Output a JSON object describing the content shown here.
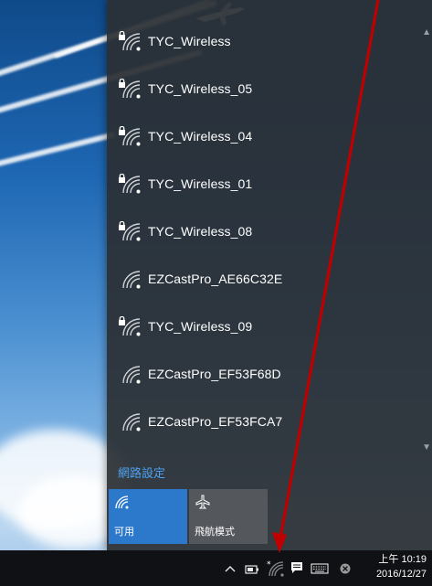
{
  "networks": [
    {
      "name": "TYC_Wireless",
      "secured": true
    },
    {
      "name": "TYC_Wireless_05",
      "secured": true
    },
    {
      "name": "TYC_Wireless_04",
      "secured": true
    },
    {
      "name": "TYC_Wireless_01",
      "secured": true
    },
    {
      "name": "TYC_Wireless_08",
      "secured": true
    },
    {
      "name": "EZCastPro_AE66C32E",
      "secured": false
    },
    {
      "name": "TYC_Wireless_09",
      "secured": true
    },
    {
      "name": "EZCastPro_EF53F68D",
      "secured": false
    },
    {
      "name": "EZCastPro_EF53FCA7",
      "secured": false
    }
  ],
  "network_settings_link": "網路設定",
  "tiles": {
    "wifi": {
      "label": "可用",
      "icon": "wifi-icon",
      "active": true
    },
    "airplane": {
      "label": "飛航模式",
      "icon": "airplane-icon",
      "active": false
    }
  },
  "taskbar": {
    "tray_icons": [
      "chevron-up-icon",
      "battery-icon",
      "wifi-icon",
      "action-center-icon",
      "keyboard-icon",
      "close-circle-icon"
    ],
    "clock_time": "上午 10:19",
    "clock_date": "2016/12/27"
  },
  "colors": {
    "flyout_bg": "#2b2f34",
    "accent": "#2c78cb",
    "link": "#4ea1f0",
    "arrow": "#c00000"
  }
}
